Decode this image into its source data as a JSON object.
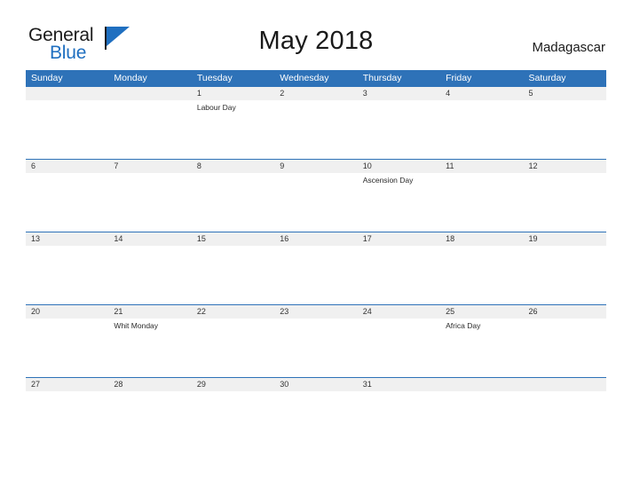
{
  "branding": {
    "name_part1": "General",
    "name_part2": "Blue",
    "flag_icon": "flag-icon"
  },
  "header": {
    "title": "May 2018",
    "locale": "Madagascar"
  },
  "calendar": {
    "weekdays": [
      "Sunday",
      "Monday",
      "Tuesday",
      "Wednesday",
      "Thursday",
      "Friday",
      "Saturday"
    ],
    "header_bg": "#2e72b8",
    "daterow_bg": "#f0f0f0",
    "row_border": "#2e72b8",
    "weeks": [
      {
        "days": [
          {
            "num": "",
            "event": ""
          },
          {
            "num": "",
            "event": ""
          },
          {
            "num": "1",
            "event": "Labour Day"
          },
          {
            "num": "2",
            "event": ""
          },
          {
            "num": "3",
            "event": ""
          },
          {
            "num": "4",
            "event": ""
          },
          {
            "num": "5",
            "event": ""
          }
        ]
      },
      {
        "days": [
          {
            "num": "6",
            "event": ""
          },
          {
            "num": "7",
            "event": ""
          },
          {
            "num": "8",
            "event": ""
          },
          {
            "num": "9",
            "event": ""
          },
          {
            "num": "10",
            "event": "Ascension Day"
          },
          {
            "num": "11",
            "event": ""
          },
          {
            "num": "12",
            "event": ""
          }
        ]
      },
      {
        "days": [
          {
            "num": "13",
            "event": ""
          },
          {
            "num": "14",
            "event": ""
          },
          {
            "num": "15",
            "event": ""
          },
          {
            "num": "16",
            "event": ""
          },
          {
            "num": "17",
            "event": ""
          },
          {
            "num": "18",
            "event": ""
          },
          {
            "num": "19",
            "event": ""
          }
        ]
      },
      {
        "days": [
          {
            "num": "20",
            "event": ""
          },
          {
            "num": "21",
            "event": "Whit Monday"
          },
          {
            "num": "22",
            "event": ""
          },
          {
            "num": "23",
            "event": ""
          },
          {
            "num": "24",
            "event": ""
          },
          {
            "num": "25",
            "event": "Africa Day"
          },
          {
            "num": "26",
            "event": ""
          }
        ]
      },
      {
        "days": [
          {
            "num": "27",
            "event": ""
          },
          {
            "num": "28",
            "event": ""
          },
          {
            "num": "29",
            "event": ""
          },
          {
            "num": "30",
            "event": ""
          },
          {
            "num": "31",
            "event": ""
          },
          {
            "num": "",
            "event": ""
          },
          {
            "num": "",
            "event": ""
          }
        ]
      }
    ]
  }
}
